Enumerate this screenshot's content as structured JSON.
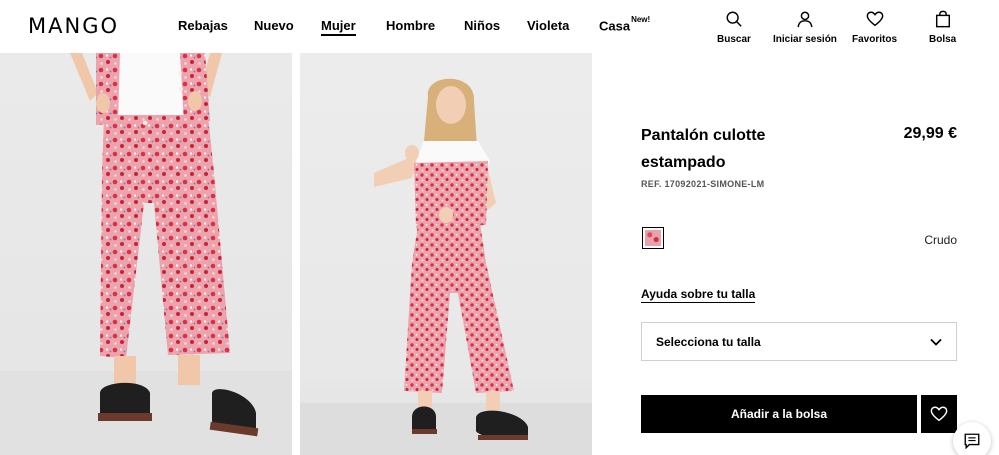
{
  "header": {
    "logo": "MANGO",
    "nav": [
      {
        "label": "Rebajas"
      },
      {
        "label": "Nuevo"
      },
      {
        "label": "Mujer"
      },
      {
        "label": "Hombre"
      },
      {
        "label": "Niños"
      },
      {
        "label": "Violeta"
      },
      {
        "label": "Casa",
        "badge": "New!"
      }
    ],
    "tools": {
      "search": "Buscar",
      "login": "Iniciar sesión",
      "favorites": "Favoritos",
      "bag": "Bolsa"
    }
  },
  "product": {
    "title": "Pantalón culotte estampado",
    "price": "29,99 €",
    "ref": "REF. 17092021-SIMONE-LM",
    "color": "Crudo",
    "size_help": "Ayuda sobre tu talla",
    "size_select": "Selecciona tu talla",
    "add_to_bag": "Añadir a la bolsa"
  },
  "colors": {
    "accent": "#000000",
    "print_pink": "#e9a2ab",
    "print_red": "#c93040"
  }
}
